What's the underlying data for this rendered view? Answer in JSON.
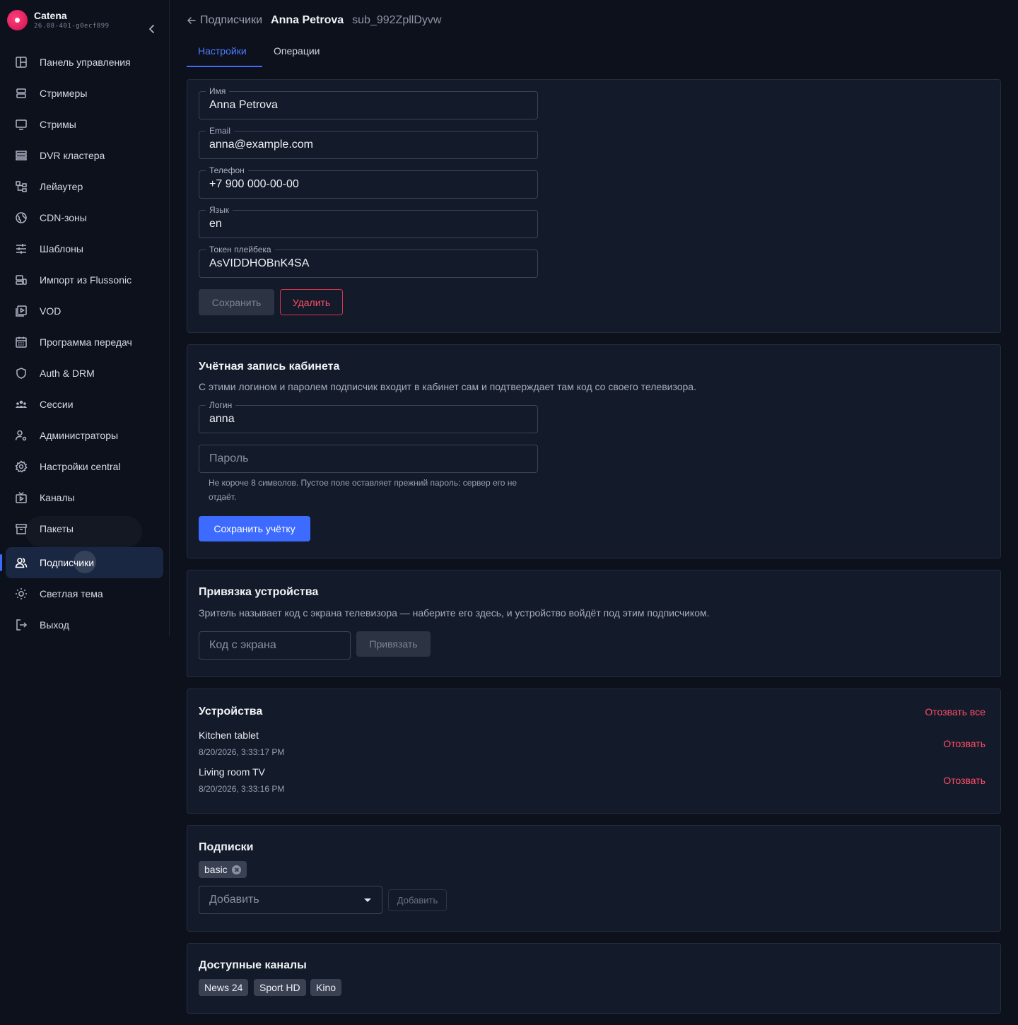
{
  "brand": {
    "name": "Catena",
    "version": "26.08-401-g0ecf899"
  },
  "sidebar": {
    "items": [
      {
        "label": "Панель управления",
        "icon": "dashboard-icon"
      },
      {
        "label": "Стримеры",
        "icon": "server-icon"
      },
      {
        "label": "Стримы",
        "icon": "monitor-icon"
      },
      {
        "label": "DVR кластера",
        "icon": "storage-icon"
      },
      {
        "label": "Лейаутер",
        "icon": "layout-tree-icon"
      },
      {
        "label": "CDN-зоны",
        "icon": "globe-icon"
      },
      {
        "label": "Шаблоны",
        "icon": "sliders-icon"
      },
      {
        "label": "Импорт из Flussonic",
        "icon": "import-icon"
      },
      {
        "label": "VOD",
        "icon": "video-file-icon"
      },
      {
        "label": "Программа передач",
        "icon": "calendar-icon"
      },
      {
        "label": "Auth & DRM",
        "icon": "shield-icon"
      },
      {
        "label": "Сессии",
        "icon": "users-group-icon"
      },
      {
        "label": "Администраторы",
        "icon": "user-gear-icon"
      },
      {
        "label": "Настройки central",
        "icon": "gear-icon"
      },
      {
        "label": "Каналы",
        "icon": "tv-icon"
      },
      {
        "label": "Пакеты",
        "icon": "archive-icon"
      },
      {
        "label": "Подписчики",
        "icon": "users-icon",
        "active": true
      },
      {
        "label": "Светлая тема",
        "icon": "sun-icon"
      },
      {
        "label": "Выход",
        "icon": "logout-icon"
      }
    ]
  },
  "breadcrumb": {
    "back_label": "Подписчики",
    "subscriber_name": "Anna Petrova",
    "subscriber_id": "sub_992ZpllDyvw"
  },
  "tabs": {
    "settings": "Настройки",
    "operations": "Операции",
    "active": "settings"
  },
  "profile": {
    "name_label": "Имя",
    "name_value": "Anna Petrova",
    "email_label": "Email",
    "email_value": "anna@example.com",
    "phone_label": "Телефон",
    "phone_value": "+7 900 000-00-00",
    "lang_label": "Язык",
    "lang_value": "en",
    "token_label": "Токен плейбека",
    "token_value": "AsVIDDHOBnK4SA",
    "save_label": "Сохранить",
    "delete_label": "Удалить"
  },
  "account": {
    "title": "Учётная запись кабинета",
    "description": "С этими логином и паролем подписчик входит в кабинет сам и подтверждает там код со своего телевизора.",
    "login_label": "Логин",
    "login_value": "anna",
    "password_placeholder": "Пароль",
    "password_help": "Не короче 8 символов. Пустое поле оставляет прежний пароль: сервер его не отдаёт.",
    "save_label": "Сохранить учётку"
  },
  "binding": {
    "title": "Привязка устройства",
    "description": "Зритель называет код с экрана телевизора — наберите его здесь, и устройство войдёт под этим подписчиком.",
    "code_placeholder": "Код с экрана",
    "bind_label": "Привязать"
  },
  "devices": {
    "title": "Устройства",
    "revoke_all_label": "Отозвать все",
    "revoke_label": "Отозвать",
    "items": [
      {
        "name": "Kitchen tablet",
        "time": "8/20/2026, 3:33:17 PM"
      },
      {
        "name": "Living room TV",
        "time": "8/20/2026, 3:33:16 PM"
      }
    ]
  },
  "subscriptions": {
    "title": "Подписки",
    "chips": [
      "basic"
    ],
    "select_placeholder": "Добавить",
    "add_label": "Добавить"
  },
  "channels": {
    "title": "Доступные каналы",
    "chips": [
      "News 24",
      "Sport HD",
      "Kino"
    ]
  },
  "colors": {
    "accent": "#3d6bff",
    "danger": "#ff4d68",
    "background": "#0d111c",
    "card": "#131a29"
  }
}
